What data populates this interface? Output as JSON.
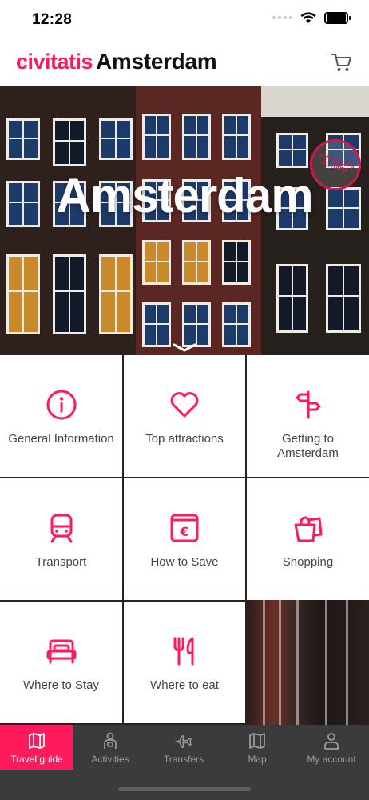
{
  "status_bar": {
    "time": "12:28",
    "icons": [
      "signal-dots-icon",
      "wifi-icon",
      "battery-icon"
    ]
  },
  "header": {
    "brand": "civitatis",
    "city": "Amsterdam",
    "cart_icon": "cart-icon",
    "brand_color": "#ff1a5b"
  },
  "hero": {
    "title": "Amsterdam",
    "stamp_text": "TOP SELLING CIVITATIS",
    "chevron_icon": "chevron-down-icon"
  },
  "categories": [
    {
      "label": "General Information",
      "icon": "info-icon"
    },
    {
      "label": "Top attractions",
      "icon": "heart-icon"
    },
    {
      "label": "Getting to Amsterdam",
      "icon": "signpost-icon"
    },
    {
      "label": "Transport",
      "icon": "train-icon"
    },
    {
      "label": "How to Save",
      "icon": "euro-wallet-icon"
    },
    {
      "label": "Shopping",
      "icon": "shopping-bags-icon"
    },
    {
      "label": "Where to Stay",
      "icon": "bed-icon"
    },
    {
      "label": "Where to eat",
      "icon": "fork-knife-icon"
    }
  ],
  "bottom_nav": {
    "items": [
      {
        "label": "Travel guide",
        "icon": "map-book-icon",
        "active": true
      },
      {
        "label": "Activities",
        "icon": "guide-person-icon",
        "active": false
      },
      {
        "label": "Transfers",
        "icon": "plane-icon",
        "active": false
      },
      {
        "label": "Map",
        "icon": "map-icon",
        "active": false
      },
      {
        "label": "My account",
        "icon": "user-icon",
        "active": false
      }
    ],
    "active_color": "#ff1a5b"
  }
}
